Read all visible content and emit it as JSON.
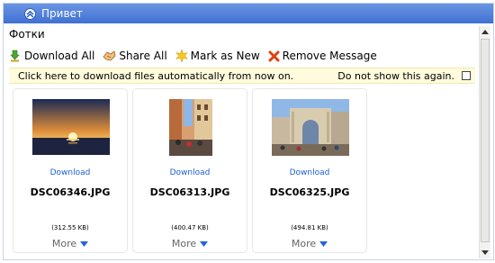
{
  "header": {
    "title": "Привет"
  },
  "subject": "Фотки",
  "toolbar": {
    "download_all": "Download All",
    "share_all": "Share All",
    "mark_as_new": "Mark as New",
    "remove_message": "Remove Message"
  },
  "notice": {
    "text": "Click here to download files automatically from now on.",
    "dismiss_label": "Do not show this again."
  },
  "attachments": [
    {
      "download": "Download",
      "filename": "DSC06346.JPG",
      "size": "(312.55 KB)",
      "more": "More"
    },
    {
      "download": "Download",
      "filename": "DSC06313.JPG",
      "size": "(400.47 KB)",
      "more": "More"
    },
    {
      "download": "Download",
      "filename": "DSC06325.JPG",
      "size": "(494.81 KB)",
      "more": "More"
    }
  ],
  "colors": {
    "accent": "#3f71d2",
    "link": "#1c5ed9",
    "notice_bg": "#fffbdc"
  }
}
